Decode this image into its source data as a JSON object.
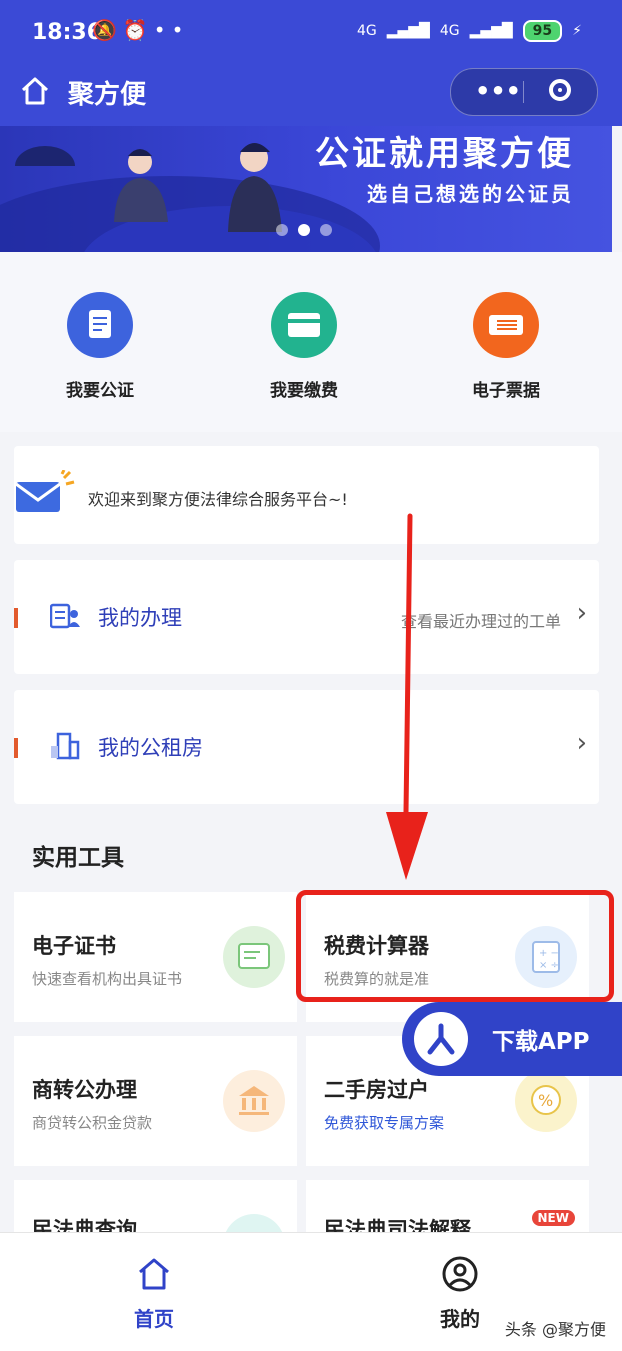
{
  "status_bar": {
    "time": "18:36",
    "network": "4G",
    "battery": "95"
  },
  "header": {
    "title": "聚方便",
    "more_label": "•••"
  },
  "banner": {
    "title": "公证就用聚方便",
    "subtitle": "选自己想选的公证员"
  },
  "quick_actions": [
    {
      "label": "我要公证",
      "icon": "document-icon",
      "color": "#3d63dd"
    },
    {
      "label": "我要缴费",
      "icon": "card-icon",
      "color": "#22b38f"
    },
    {
      "label": "电子票据",
      "icon": "ticket-icon",
      "color": "#f2661e"
    }
  ],
  "notice": {
    "text": "欢迎来到聚方便法律综合服务平台~!"
  },
  "rows": [
    {
      "label": "我的办理",
      "hint": "查看最近办理过的工单"
    },
    {
      "label": "我的公租房",
      "hint": ""
    }
  ],
  "tools": {
    "title": "实用工具",
    "items": [
      {
        "title": "电子证书",
        "subtitle": "快速查看机构出具证书",
        "color": "#dff2dc"
      },
      {
        "title": "税费计算器",
        "subtitle": "税费算的就是准",
        "color": "#e6f0fc"
      },
      {
        "title": "商转公办理",
        "subtitle": "商贷转公积金贷款",
        "color": "#fdeedd"
      },
      {
        "title": "二手房过户",
        "subtitle": "免费获取专属方案",
        "color": "#fbf3cc"
      },
      {
        "title": "民法典查询",
        "subtitle": "",
        "color": "#dff5f2"
      },
      {
        "title": "民法典司法解释",
        "subtitle": "",
        "color": "#f7f7f7"
      }
    ],
    "new_badge": "NEW"
  },
  "download": {
    "label": "下载APP"
  },
  "bottom_nav": [
    {
      "label": "首页",
      "active": true
    },
    {
      "label": "我的",
      "active": false
    }
  ],
  "watermark": "头条 @聚方便",
  "colors": {
    "primary": "#3b4ad6",
    "highlight": "#e8221b"
  }
}
